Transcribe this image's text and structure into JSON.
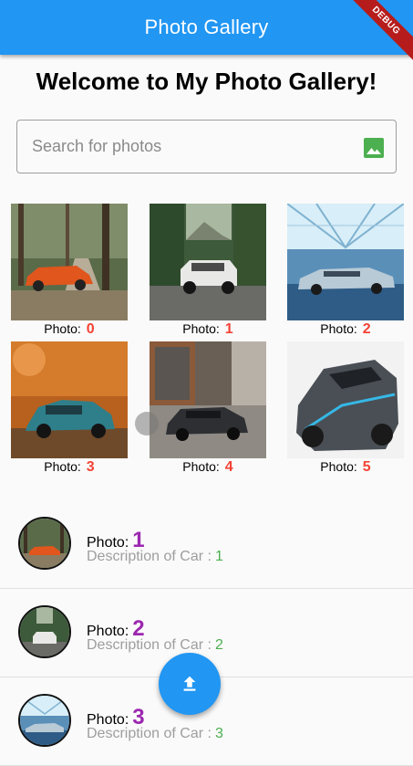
{
  "appbar": {
    "title": "Photo Gallery",
    "debug_label": "DEBUG"
  },
  "welcome": "Welcome to My Photo Gallery!",
  "search": {
    "placeholder": "Search for photos",
    "value": ""
  },
  "grid": {
    "caption_prefix": "Photo:",
    "items": [
      {
        "number": "0",
        "icon": "photo-car-orange"
      },
      {
        "number": "1",
        "icon": "photo-jeep-white"
      },
      {
        "number": "2",
        "icon": "photo-car-blue"
      },
      {
        "number": "3",
        "icon": "photo-car-teal"
      },
      {
        "number": "4",
        "icon": "photo-car-dark"
      },
      {
        "number": "5",
        "icon": "photo-car-grey"
      }
    ]
  },
  "list": {
    "label_prefix": "Photo:",
    "desc_prefix": "Description of Car :",
    "items": [
      {
        "number": "1",
        "desc_number": "1"
      },
      {
        "number": "2",
        "desc_number": "2"
      },
      {
        "number": "3",
        "desc_number": "3"
      }
    ]
  },
  "fab": {
    "icon": "upload-icon"
  },
  "colors": {
    "primary": "#2196f3",
    "caption_number": "#f44336",
    "list_number": "#9c27b0",
    "desc_number": "#4caf50",
    "debug": "#b71c1c"
  }
}
